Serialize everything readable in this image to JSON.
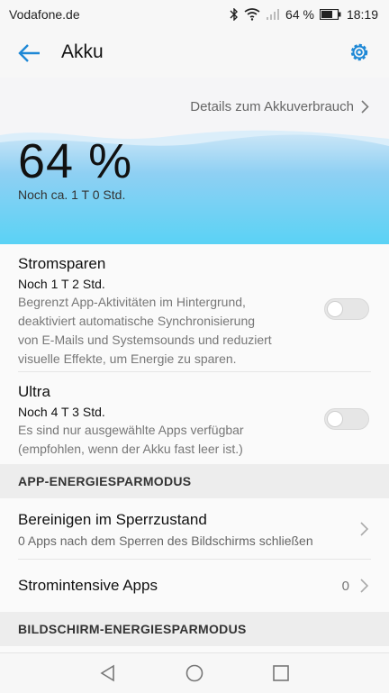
{
  "status_bar": {
    "carrier": "Vodafone.de",
    "battery": "64 %",
    "time": "18:19"
  },
  "app_bar": {
    "title": "Akku"
  },
  "hero": {
    "details_link": "Details zum Akkuverbrauch",
    "percent": "64 %",
    "remaining": "Noch ca. 1 T 0 Std."
  },
  "power_saving": {
    "title": "Stromsparen",
    "subtitle": "Noch 1 T 2 Std.",
    "desc_lines": [
      "Begrenzt App-Aktivitäten im Hintergrund,",
      "deaktiviert automatische Synchronisierung",
      "von E-Mails und Systemsounds und reduziert",
      "visuelle Effekte, um Energie zu sparen."
    ],
    "enabled": false
  },
  "ultra": {
    "title": "Ultra",
    "subtitle": "Noch 4 T 3 Std.",
    "desc_lines": [
      "Es sind nur ausgewählte Apps verfügbar",
      "(empfohlen, wenn der Akku fast leer ist.)"
    ],
    "enabled": false
  },
  "sections": {
    "app_mode": "APP-ENERGIESPARMODUS",
    "screen_mode": "BILDSCHIRM-ENERGIESPARMODUS"
  },
  "clean_locked": {
    "title": "Bereinigen im Sperrzustand",
    "desc": "0 Apps nach dem Sperren des Bildschirms schließen"
  },
  "intensive_apps": {
    "title": "Stromintensive Apps",
    "count": "0"
  },
  "colors": {
    "accent": "#1e88d6",
    "wave_top": "#c9e5f7",
    "wave_bottom": "#5ad2f5"
  }
}
